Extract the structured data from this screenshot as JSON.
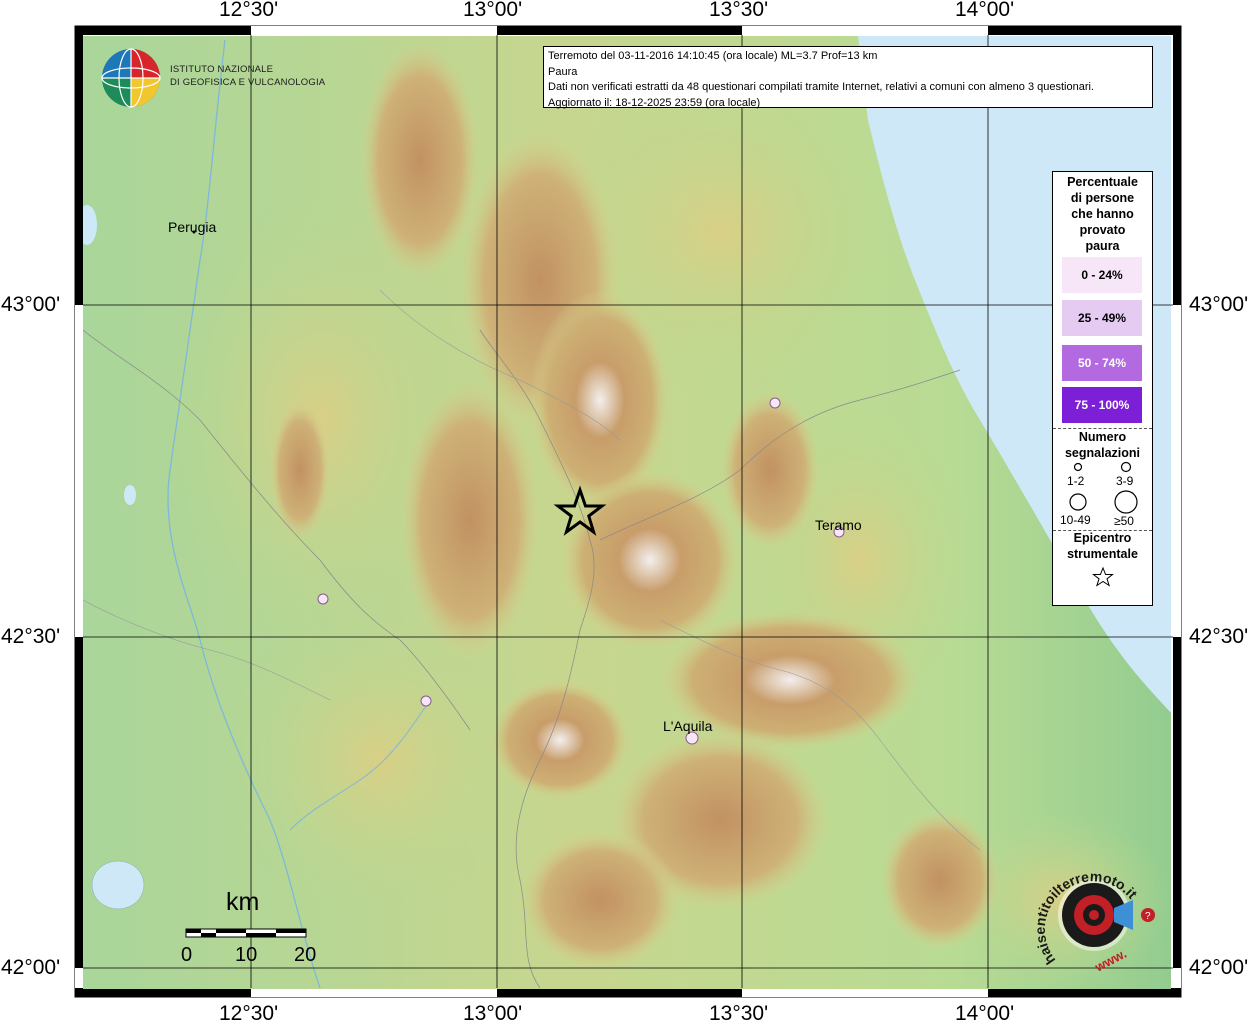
{
  "axis_labels": {
    "lon": [
      "12°30'",
      "13°00'",
      "13°30'",
      "14°00'"
    ],
    "lat": [
      "43°00'",
      "42°30'",
      "42°00'"
    ]
  },
  "logo": {
    "line1": "ISTITUTO NAZIONALE",
    "line2": "DI GEOFISICA E VULCANOLOGIA"
  },
  "info": {
    "line1": "Terremoto del 03-11-2016 14:10:45 (ora locale) ML=3.7 Prof=13 km",
    "line2": "Paura",
    "line3": "Dati non verificati estratti da 48 questionari compilati tramite Internet, relativi a comuni con almeno 3 questionari.",
    "line4": "Aggiornato il: 18-12-2025 23:59 (ora locale)"
  },
  "cities": [
    {
      "name": "Perugia"
    },
    {
      "name": "Teramo"
    },
    {
      "name": "L'Aquila"
    }
  ],
  "legend": {
    "title": "Percentuale di persone che hanno provato paura",
    "title_lines": [
      "Percentuale",
      "di persone",
      "che hanno",
      "provato",
      "paura"
    ],
    "classes": [
      {
        "label": "0 - 24%",
        "color": "#f7e6f7"
      },
      {
        "label": "25 - 49%",
        "color": "#e5cbf2"
      },
      {
        "label": "50 - 74%",
        "color": "#b36ae0"
      },
      {
        "label": "75 - 100%",
        "color": "#7c1fd6"
      }
    ],
    "count_title_lines": [
      "Numero",
      "segnalazioni"
    ],
    "count_classes": [
      "1-2",
      "3-9",
      "10-49",
      "≥50"
    ],
    "epicenter_lines": [
      "Epicentro",
      "strumentale"
    ]
  },
  "scale": {
    "unit": "km",
    "ticks": [
      "0",
      "10",
      "20"
    ]
  },
  "brand": {
    "line1": "haisentitoilterremoto.it",
    "line2": "www."
  },
  "colors": {
    "sea": "#cfe8f8",
    "lowland": "#9fd19a",
    "hills": "#d6d18c",
    "mountain": "#c4a06a",
    "peaks": "#f3efee",
    "marker_fill": "#f7e6f7",
    "marker_stroke": "#8a5a8a"
  }
}
